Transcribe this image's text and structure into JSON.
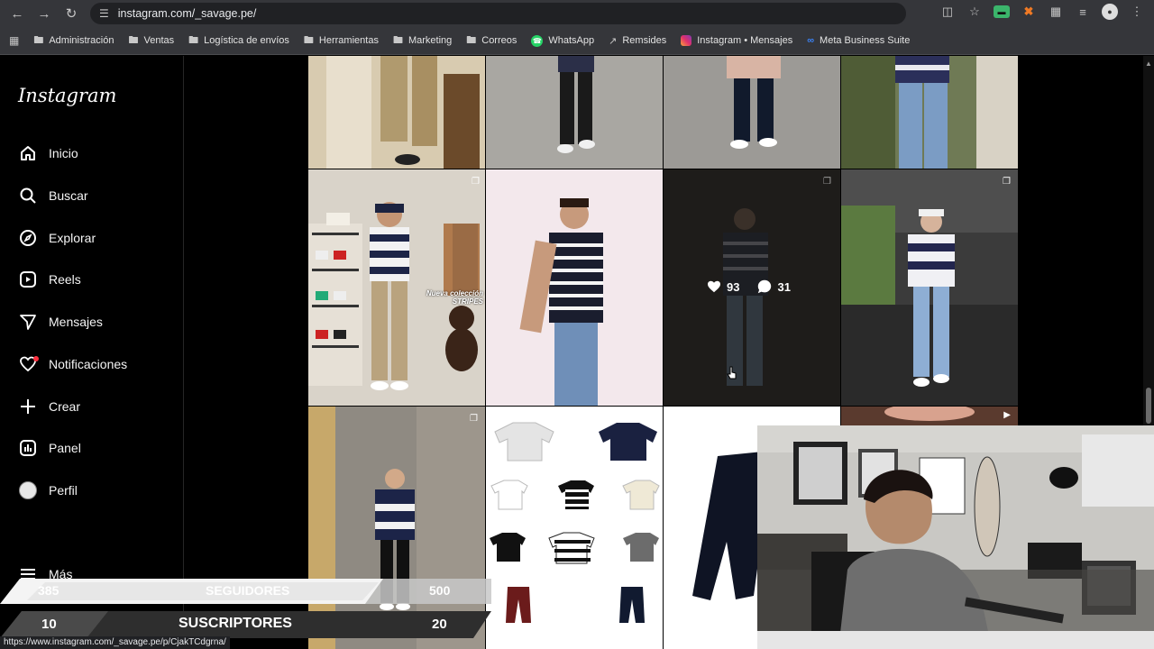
{
  "browser": {
    "url": "instagram.com/_savage.pe/",
    "status_url": "https://www.instagram.com/_savage.pe/p/CjakTCdgrna/"
  },
  "bookmarks": [
    {
      "label": "Administración",
      "icon": "folder-icon"
    },
    {
      "label": "Ventas",
      "icon": "folder-icon"
    },
    {
      "label": "Logística de envíos",
      "icon": "folder-icon"
    },
    {
      "label": "Herramientas",
      "icon": "folder-icon"
    },
    {
      "label": "Marketing",
      "icon": "folder-icon"
    },
    {
      "label": "Correos",
      "icon": "folder-icon"
    },
    {
      "label": "WhatsApp",
      "icon": "whatsapp-icon"
    },
    {
      "label": "Remsides",
      "icon": "remsides-icon"
    },
    {
      "label": "Instagram • Mensajes",
      "icon": "instagram-icon"
    },
    {
      "label": "Meta Business Suite",
      "icon": "meta-icon"
    }
  ],
  "sidebar": {
    "logo": "Instagram",
    "items": [
      {
        "label": "Inicio",
        "icon": "home-icon"
      },
      {
        "label": "Buscar",
        "icon": "search-icon"
      },
      {
        "label": "Explorar",
        "icon": "compass-icon"
      },
      {
        "label": "Reels",
        "icon": "reels-icon"
      },
      {
        "label": "Mensajes",
        "icon": "messenger-icon"
      },
      {
        "label": "Notificaciones",
        "icon": "heart-icon"
      },
      {
        "label": "Crear",
        "icon": "plus-icon"
      },
      {
        "label": "Panel",
        "icon": "dashboard-icon"
      },
      {
        "label": "Perfil",
        "icon": "profile-icon"
      },
      {
        "label": "Más",
        "icon": "menu-icon"
      }
    ]
  },
  "post_hover": {
    "likes": "93",
    "comments": "31"
  },
  "post_caption": "Nueva colección STRIPES",
  "stream_overlay": {
    "followers_current": "385",
    "followers_label": "SEGUIDORES",
    "followers_goal": "500",
    "subs_current": "10",
    "subs_label": "SUSCRIPTORES",
    "subs_goal": "20"
  },
  "colors": {
    "accent": "#ffd200",
    "notif_dot": "#ff3040",
    "bg": "#000000"
  }
}
